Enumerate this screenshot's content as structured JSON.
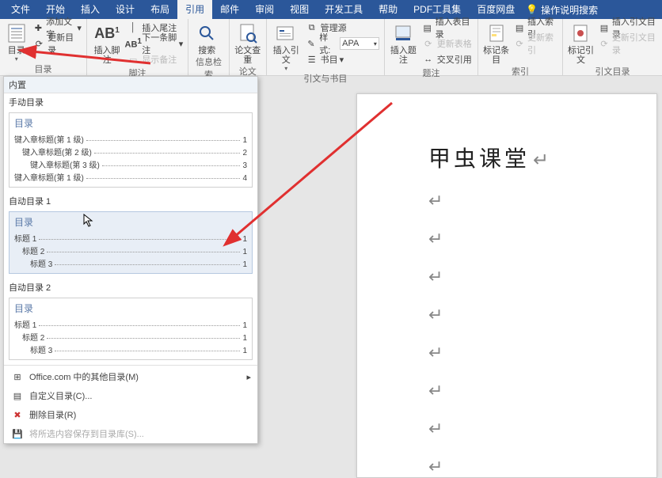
{
  "tabs": {
    "file": "文件",
    "home": "开始",
    "insert": "插入",
    "design": "设计",
    "layout": "布局",
    "references": "引用",
    "mail": "邮件",
    "review": "审阅",
    "view": "视图",
    "dev": "开发工具",
    "help": "帮助",
    "pdf": "PDF工具集",
    "baidu": "百度网盘",
    "search_placeholder": "操作说明搜索"
  },
  "ribbon": {
    "toc_group": {
      "btn": "目录",
      "add_text": "添加文字",
      "update": "更新目录",
      "label": "目录"
    },
    "footnote_group": {
      "btn": "插入脚注",
      "ab": "AB",
      "ab_sup": "1",
      "insert_endnote": "插入尾注",
      "next_footnote": "下一条脚注",
      "show_notes": "显示备注",
      "label": "脚注"
    },
    "search_group": {
      "btn": "搜索",
      "label": "信息检索"
    },
    "lookup_group": {
      "btn": "论文查重",
      "label": "论文"
    },
    "citation_group": {
      "insert_cite": "插入引文",
      "manage": "管理源",
      "style": "样式:",
      "style_value": "APA",
      "biblio": "书目",
      "label": "引文与书目"
    },
    "caption_group": {
      "insert_caption": "插入题注",
      "insert_tof": "插入表目录",
      "update_table": "更新表格",
      "cross_ref": "交叉引用",
      "label": "题注"
    },
    "index_group": {
      "mark_entry": "标记条目",
      "insert_index": "插入索引",
      "update_index": "更新索引",
      "label": "索引"
    },
    "authority_group": {
      "mark_cite": "标记引文",
      "insert_toa": "插入引文目录",
      "update_toa": "更新引文目录",
      "label": "引文目录"
    }
  },
  "dropdown": {
    "builtin": "内置",
    "manual": {
      "section": "手动目录",
      "card_title": "目录",
      "line1": "键入章标题(第 1 级)",
      "line2": "键入章标题(第 2 级)",
      "line3": "键入章标题(第 3 级)",
      "line4": "键入章标题(第 1 级)",
      "p1": "1",
      "p2": "2",
      "p3": "3",
      "p4": "4"
    },
    "auto1": {
      "section": "自动目录 1",
      "card_title": "目录",
      "h1": "标题 1",
      "h2": "标题 2",
      "h3": "标题 3",
      "p1": "1",
      "p2": "1",
      "p3": "1"
    },
    "auto2": {
      "section": "自动目录 2",
      "card_title": "目录",
      "h1": "标题 1",
      "h2": "标题 2",
      "h3": "标题 3",
      "p1": "1",
      "p2": "1",
      "p3": "1"
    },
    "office_more": "Office.com 中的其他目录(M)",
    "custom": "自定义目录(C)...",
    "remove": "删除目录(R)",
    "save_gallery": "将所选内容保存到目录库(S)..."
  },
  "doc": {
    "title": "甲虫课堂"
  }
}
